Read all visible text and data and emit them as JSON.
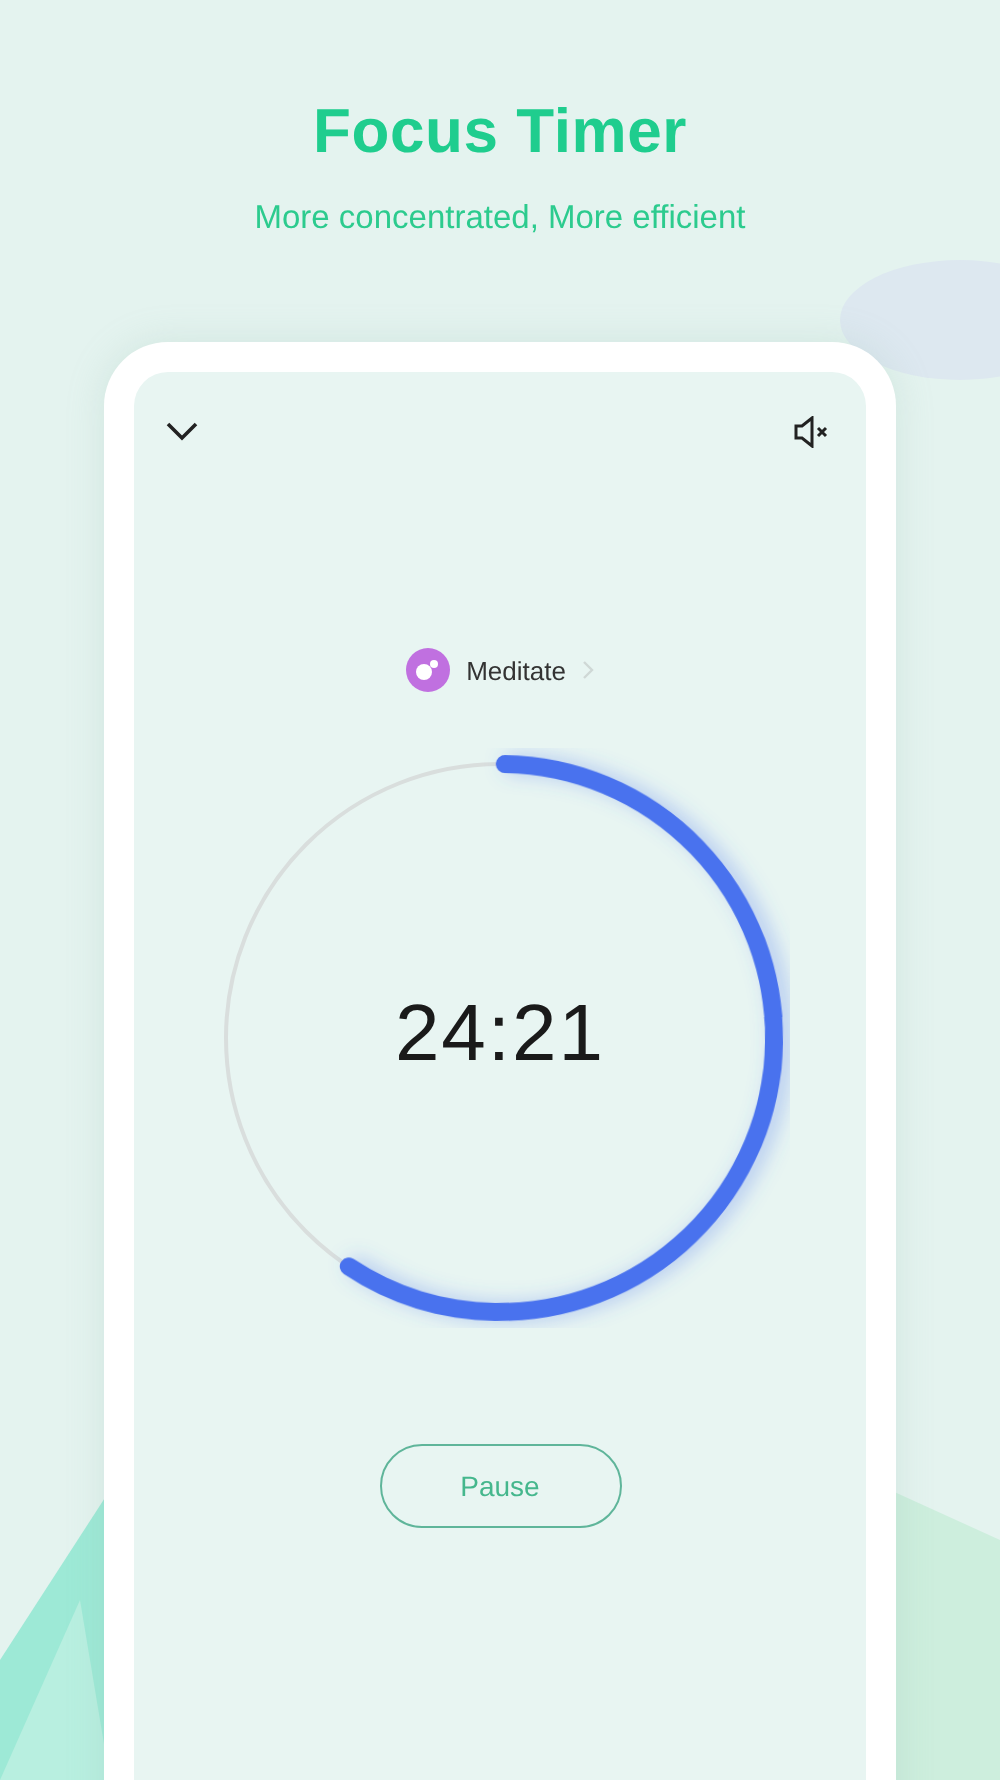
{
  "header": {
    "title": "Focus Timer",
    "subtitle": "More concentrated, More efficient"
  },
  "screen": {
    "sound_muted": true,
    "category": {
      "label": "Meditate",
      "color": "#c070e0"
    },
    "timer": {
      "time": "24:21",
      "level": 0.59
    },
    "buttons": [
      {
        "label": "Pause"
      }
    ]
  }
}
